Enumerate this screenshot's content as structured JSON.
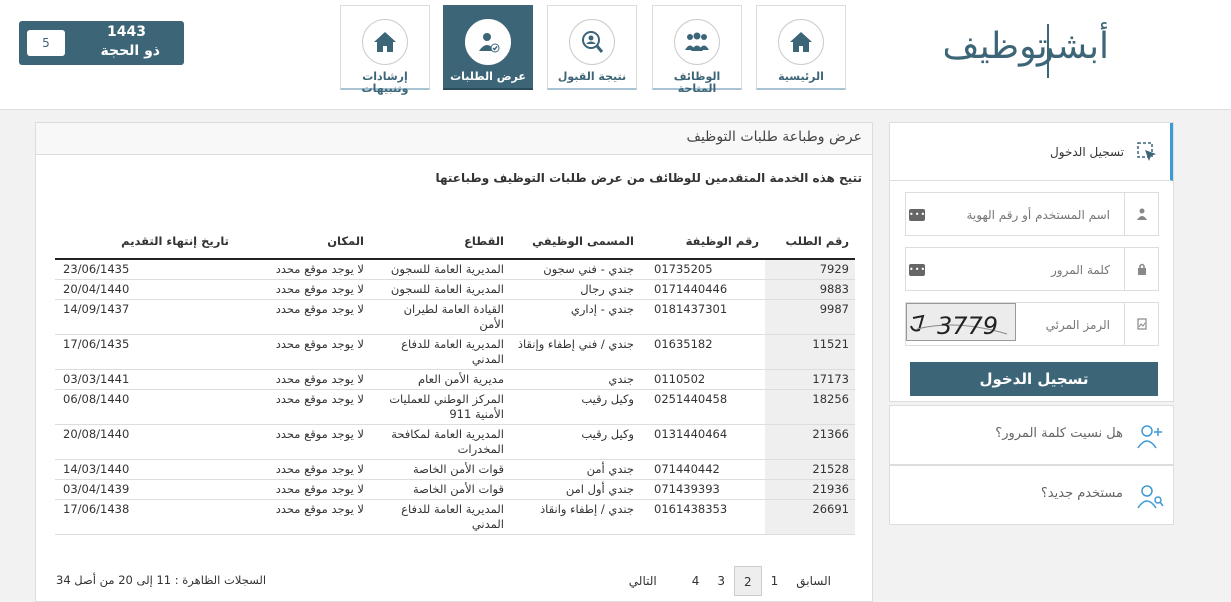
{
  "header": {
    "date": {
      "day": "5",
      "year": "1443",
      "month": "ذو الحجة"
    },
    "nav": [
      {
        "key": "home",
        "label": "الرئيسية"
      },
      {
        "key": "jobs",
        "label": "الوظائف المتاحة"
      },
      {
        "key": "result",
        "label": "نتيجة القبول"
      },
      {
        "key": "requests",
        "label": "عرض الطلبات"
      },
      {
        "key": "guidance",
        "label": "إرشادات وتنبيهات"
      }
    ],
    "logo": {
      "word1": "أبشر",
      "word2": "توظيف"
    }
  },
  "main": {
    "title": "عرض وطباعة طلبات التوظيف",
    "subtitle": "تتيح هذه الخدمة المتقدمين للوظائف من عرض طلبات التوظيف وطباعتها",
    "table": {
      "headers": [
        "رقم الطلب",
        "رقم الوظيفة",
        "المسمى الوظيفي",
        "القطاع",
        "المكان",
        "تاريخ إنتهاء التقديم"
      ],
      "rows": [
        [
          "7929",
          "01735205",
          "جندي - فني سجون",
          "المديرية العامة للسجون",
          "لا يوجد موقع محدد",
          "23/06/1435"
        ],
        [
          "9883",
          "0171440446",
          "جندي رجال",
          "المديرية العامة للسجون",
          "لا يوجد موقع محدد",
          "20/04/1440"
        ],
        [
          "9987",
          "0181437301",
          "جندي - إداري",
          "القيادة العامة لطيران الأمن",
          "لا يوجد موقع محدد",
          "14/09/1437"
        ],
        [
          "11521",
          "01635182",
          "جندي / فني إطفاء وإنقاذ",
          "المديرية العامة للدفاع المدني",
          "لا يوجد موقع محدد",
          "17/06/1435"
        ],
        [
          "17173",
          "0110502",
          "جندي",
          "مديرية الأمن العام",
          "لا يوجد موقع محدد",
          "03/03/1441"
        ],
        [
          "18256",
          "0251440458",
          "وكيل رقيب",
          "المركز الوطني للعمليات الأمنية 911",
          "لا يوجد موقع محدد",
          "06/08/1440"
        ],
        [
          "21366",
          "0131440464",
          "وكيل رقيب",
          "المديرية العامة لمكافحة المخدرات",
          "لا يوجد موقع محدد",
          "20/08/1440"
        ],
        [
          "21528",
          "071440442",
          "جندي أمن",
          "قوات الأمن الخاصة",
          "لا يوجد موقع محدد",
          "14/03/1440"
        ],
        [
          "21936",
          "071439393",
          "جندي أول امن",
          "قوات الأمن الخاصة",
          "لا يوجد موقع محدد",
          "03/04/1439"
        ],
        [
          "26691",
          "0161438353",
          "جندي / إطفاء وانقاذ",
          "المديرية العامة للدفاع المدني",
          "لا يوجد موقع محدد",
          "17/06/1438"
        ]
      ]
    },
    "records": "السجلات الظاهرة : 11 إلى 20 من أصل 34",
    "pager": {
      "prev": "السابق",
      "pages": [
        "1",
        "2",
        "3",
        "4"
      ],
      "current": "2",
      "next": "التالي"
    }
  },
  "login": {
    "title": "تسجيل الدخول",
    "username_placeholder": "اسم المستخدم أو رقم الهوية",
    "password_placeholder": "كلمة المرور",
    "captcha_placeholder": "الرمز المرئي",
    "captcha_text": "3779",
    "submit": "تسجيل الدخول"
  },
  "links": {
    "forgot": "هل نسيت كلمة المرور؟",
    "new_user": "مستخدم جديد؟"
  },
  "colors": {
    "primary": "#3d6578",
    "accent": "#3d9ad6"
  }
}
